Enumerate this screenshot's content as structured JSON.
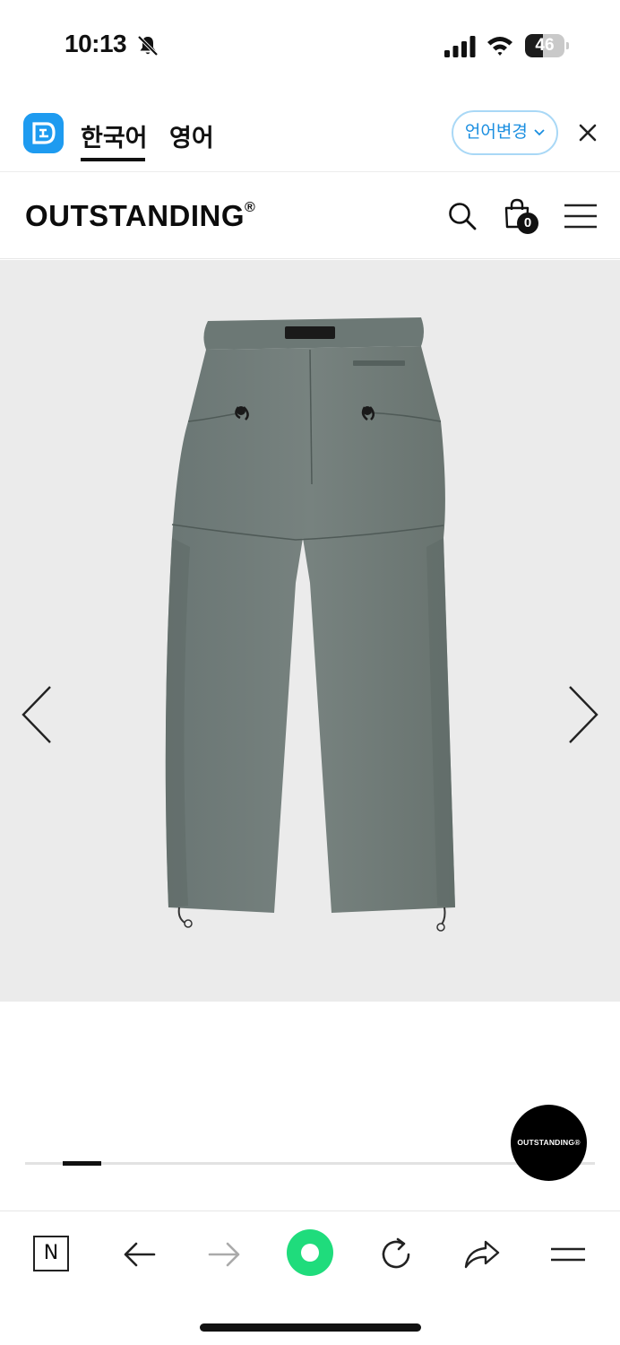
{
  "status_bar": {
    "time": "10:13",
    "battery_level": "46",
    "battery_fraction": 0.46,
    "icons": [
      "bell-off-icon",
      "signal-icon",
      "wifi-icon",
      "battery-icon"
    ]
  },
  "translate_bar": {
    "tabs": [
      {
        "label": "한국어",
        "active": true
      },
      {
        "label": "영어",
        "active": false
      }
    ],
    "change_language_label": "언어변경",
    "accent_color": "#1e9bf0"
  },
  "header": {
    "brand": "OUTSTANDING",
    "brand_mark": "®",
    "cart_count": "0"
  },
  "gallery": {
    "current_slide_fraction": 0.08,
    "background": "#ebebeb",
    "product_color": "#6e7a78"
  },
  "floating_badge": {
    "label": "OUTSTANDING®"
  },
  "browser_toolbar": {
    "naver_label": "N",
    "accent_color": "#1fdc7c"
  }
}
